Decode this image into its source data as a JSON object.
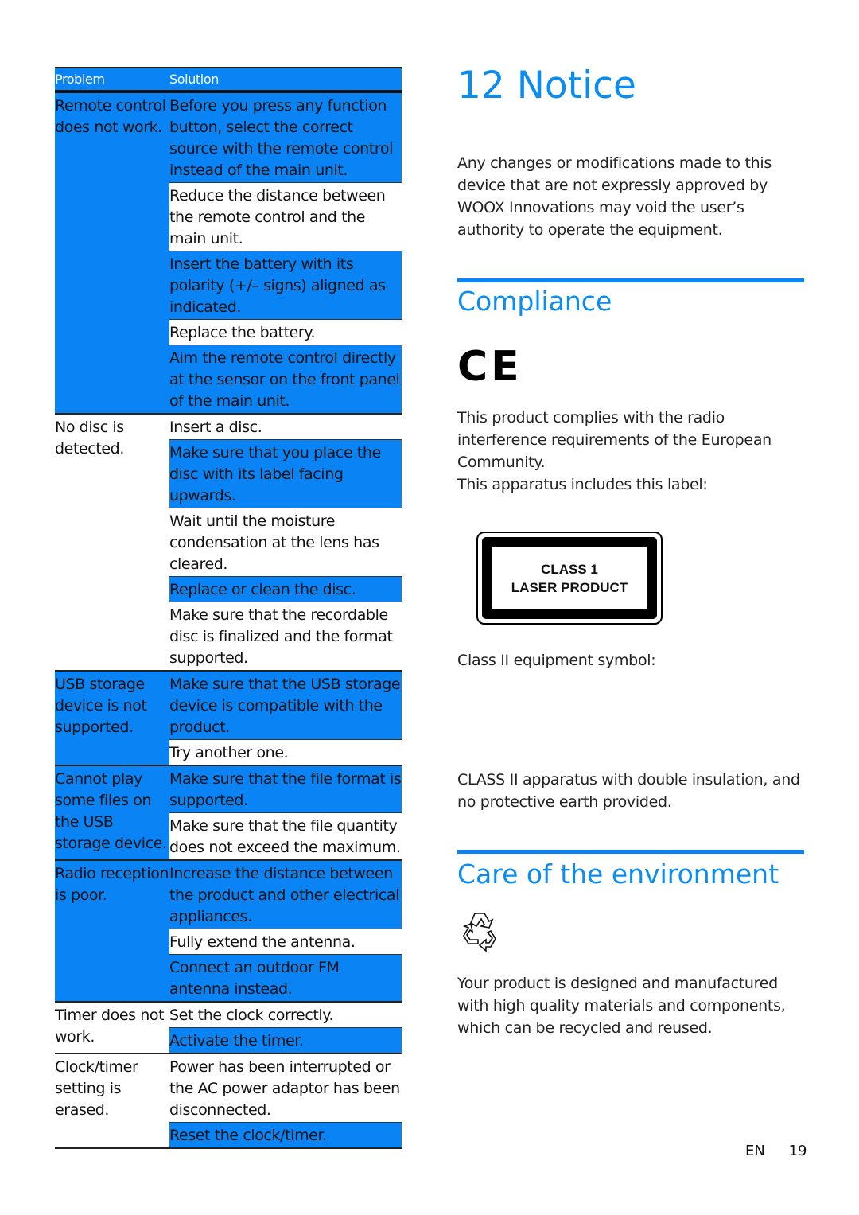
{
  "troubleshooting": {
    "header": {
      "problem": "Problem",
      "solution": "Solution"
    },
    "rows": [
      {
        "problem": "Remote control does not work.",
        "highlight": true,
        "solutions": [
          {
            "text": "Before you press any function button, select the correct source with the remote control instead of the main unit.",
            "highlight": true
          },
          {
            "text": "Reduce the distance between the remote control and the main unit.",
            "highlight": false
          },
          {
            "text": "Insert the battery with its polarity (+/– signs) aligned as indicated.",
            "highlight": true
          },
          {
            "text": "Replace the battery.",
            "highlight": false
          },
          {
            "text": "Aim the remote control directly at the sensor on the front panel of the main unit.",
            "highlight": true
          }
        ]
      },
      {
        "problem": "No disc is detected.",
        "highlight": false,
        "solutions": [
          {
            "text": "Insert a disc.",
            "highlight": false
          },
          {
            "text": "Make sure that you place the disc with its label facing upwards.",
            "highlight": true
          },
          {
            "text": "Wait until the moisture condensation at the lens has cleared.",
            "highlight": false
          },
          {
            "text": "Replace or clean the disc.",
            "highlight": true
          },
          {
            "text": "Make sure that the recordable disc is finalized and the format supported.",
            "highlight": false
          }
        ]
      },
      {
        "problem": "USB storage device is not supported.",
        "highlight": true,
        "solutions": [
          {
            "text": "Make sure that the USB storage device is compatible with the product.",
            "highlight": true
          },
          {
            "text": "Try another one.",
            "highlight": false
          }
        ]
      },
      {
        "problem": "Cannot play some files on the USB storage device.",
        "highlight": true,
        "solutions": [
          {
            "text": "Make sure that the file format is supported.",
            "highlight": true
          },
          {
            "text": "Make sure that the file quantity does not exceed the maximum.",
            "highlight": false
          }
        ]
      },
      {
        "problem": "Radio reception is poor.",
        "highlight": true,
        "solutions": [
          {
            "text": "Increase the distance between the product and other electrical appliances.",
            "highlight": true
          },
          {
            "text": "Fully extend the antenna.",
            "highlight": false
          },
          {
            "text": "Connect an outdoor FM antenna instead.",
            "highlight": true
          }
        ]
      },
      {
        "problem": "Timer does not work.",
        "highlight": false,
        "solutions": [
          {
            "text": "Set the clock correctly.",
            "highlight": false
          },
          {
            "text": "Activate the timer.",
            "highlight": true
          }
        ]
      },
      {
        "problem": "Clock/timer setting is erased.",
        "highlight": false,
        "solutions": [
          {
            "text": "Power has been interrupted or the AC power adaptor has been disconnected.",
            "highlight": false
          },
          {
            "text": "Reset the clock/timer.",
            "highlight": true
          }
        ]
      }
    ]
  },
  "notice": {
    "title": "12 Notice",
    "intro": "Any changes or modifications made to this device that are not expressly approved by WOOX Innovations may void the user’s authority to operate the equipment."
  },
  "compliance": {
    "title": "Compliance",
    "ce_mark": "CE",
    "text": "This product complies with the radio interference requirements of the European Community.",
    "label_intro": "This apparatus includes this label:",
    "laser_label": {
      "line1": "CLASS 1",
      "line2": "LASER PRODUCT"
    },
    "class2_intro": "Class II equipment symbol:",
    "class2_text": "CLASS II apparatus with double insulation, and no protective earth provided."
  },
  "environment": {
    "title": "Care of the environment",
    "icon": "recycle-icon",
    "text": "Your product is designed and manufactured with high quality materials and components, which can be recycled and reused."
  },
  "footer": {
    "lang": "EN",
    "page": "19"
  },
  "colors": {
    "accent": "#0a84f5",
    "heading": "#0a8cf0"
  }
}
